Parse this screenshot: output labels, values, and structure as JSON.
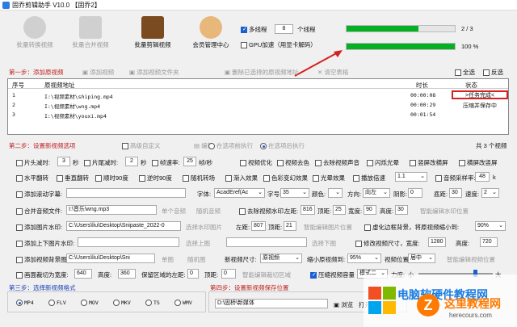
{
  "window": {
    "title": "固乔剪辑助手 V10.0 【固乔2】"
  },
  "toolbar": [
    {
      "label": "批量转换视频",
      "enabled": false
    },
    {
      "label": "批量合并视频",
      "enabled": false
    },
    {
      "label": "批量剪辑视频",
      "enabled": true
    },
    {
      "label": "会员管理中心",
      "enabled": true
    }
  ],
  "threads": {
    "multi_label": "多线程",
    "count": "8",
    "unit": "个线程",
    "gpu_label": "GPU加速（用显卡解码）"
  },
  "progress": [
    {
      "text": "2 / 3",
      "fraction": 0.667
    },
    {
      "text": "100 %",
      "fraction": 1.0
    }
  ],
  "sel": {
    "all": "全选",
    "invert": "反选"
  },
  "step1": {
    "title": "第一步：添加原视频",
    "actions": [
      "添加视频",
      "添加视频文件夹",
      "删除已选择的原视频地址",
      "清空表格"
    ]
  },
  "table": {
    "headers": [
      "序号",
      "原视频地址",
      "时长",
      "状态"
    ],
    "rows": [
      {
        "no": "1",
        "path": "I:\\视频素材\\shiping.mp4",
        "dur": "00:00:08",
        "status": ">任务完成<"
      },
      {
        "no": "2",
        "path": "I:\\视频素材\\wng.mp4",
        "dur": "00:00:29",
        "status": "压缩并保存中"
      },
      {
        "no": "3",
        "path": "I:\\视频素材\\youxi.mp4",
        "dur": "00:01:54",
        "status": ""
      }
    ]
  },
  "step2": {
    "title": "第二步：设置新视频选项",
    "adv": "高级自定义",
    "edit": "编辑",
    "order_a": "在选项前执行",
    "order_b": "在选项后执行",
    "count": "共 3 个视频"
  },
  "opts": {
    "r1": {
      "head_cut": "片头减时:",
      "head_val": "3",
      "sec1": "秒",
      "tail_cut": "片尾减时:",
      "tail_val": "2",
      "sec2": "秒",
      "fps": "帧速率:",
      "fps_val": "25",
      "fps_unit": "帧/秒",
      "optimize": "视频优化",
      "decolor": "视频去色",
      "mute": "去除视频声音",
      "flash": "闪烁光晕",
      "vblur": "竖屏改横屏",
      "hblur": "横屏改竖屏"
    },
    "r2": {
      "hflip": "水平翻转",
      "vflip": "垂直翻转",
      "cw": "顺时90度",
      "ccw": "逆时90度",
      "rand_spin": "随机转场",
      "fade": "渐入效果",
      "color": "色彩变幻效果",
      "light": "光晕效果",
      "speed": "播放倍速",
      "speed_val": "1.1",
      "sample": "音频采样率:",
      "sample_val": "48",
      "khz": "k"
    },
    "r3": {
      "sub": "添加滚动字幕:",
      "font": "字体:",
      "font_val": "AcadEref(Ac",
      "size": "字号:",
      "size_val": "35",
      "color": "颜色:",
      "dir": "方向:",
      "dir_val": "向左",
      "shadow": "阴影:",
      "shadow_val": "0",
      "bottom": "底距:",
      "bottom_val": "30",
      "speed": "速度:",
      "speed_val": "2"
    },
    "r4": {
      "merge": "合并音频文件:",
      "path": "I:\\音乐\\wng.mp3",
      "single": "单个音频",
      "rand": "随机音频",
      "wm": "去除视频水印,",
      "left": "左距:",
      "left_val": "816",
      "top": "顶距:",
      "top_val": "25",
      "w": "宽度:",
      "w_val": "90",
      "h": "高度:",
      "h_val": "30",
      "smart": "智能编辑水印位置"
    },
    "r5": {
      "img_wm": "添加图片水印:",
      "path": "C:\\Users\\liu\\Desktop\\Snipaste_2022-0",
      "choose": "选择水印图片",
      "left": "左距:",
      "left_val": "807",
      "top": "顶距:",
      "top_val": "21",
      "smart": "智能编辑图片位置",
      "blur": "虚化边框背景，将原视频缩小到:",
      "blur_val": "90%"
    },
    "r6": {
      "tb": "添加上下图片水印:",
      "up": "选择上图",
      "down": "选择下图",
      "resize": "修改视频尺寸，宽度:",
      "w_val": "1280",
      "h": "高度:",
      "h_val": "720"
    },
    "r7": {
      "bg": "添加视频背景图片:",
      "path": "C:\\Users\\liu\\Desktop\\Sni",
      "single": "单图",
      "rand": "随机图",
      "pos": "新视频尺寸:",
      "pos_val": "原视频",
      "shrink": "缩小原视频到:",
      "shrink_val": "95%",
      "vpos": "视频位置:",
      "vpos_val": "居中",
      "smart": "智能编辑视频位置"
    },
    "r8": {
      "crop": "画面裁切为宽度:",
      "w_val": "640",
      "h": "高度:",
      "h_val": "360",
      "keep": "保留区域的左距:",
      "l_val": "0",
      "top": "顶距:",
      "t_val": "0",
      "smart": "智能编辑裁切区域",
      "compress": "压缩视频容量",
      "mode": "模式二",
      "force": "力度:",
      "small": "小",
      "big": "大"
    }
  },
  "step3": {
    "title": "第三步：选择新视频格式",
    "formats": [
      "MP4",
      "FLV",
      "MOV",
      "MKV",
      "TS",
      "WMV"
    ],
    "selected": "MP4"
  },
  "step4": {
    "title": "第四步：设置新视频保存位置",
    "path": "D:\\固桥\\新媒体",
    "browse": "浏览",
    "open": "打开"
  },
  "watermark": {
    "cn": "电脑软硬件教程网",
    "site": "这里教程网",
    "url": "herecours.com"
  },
  "colors": {
    "accent": "#1a5fd0",
    "progress": "#06b025",
    "alert": "#c02020"
  }
}
